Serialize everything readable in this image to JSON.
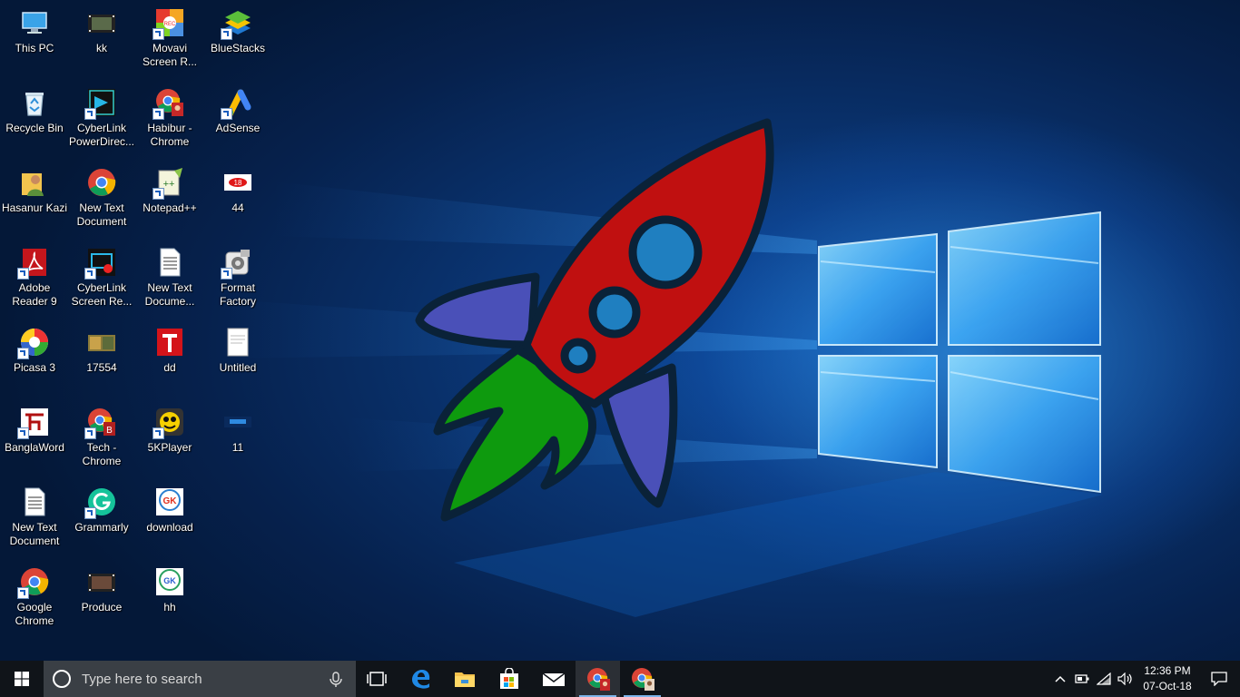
{
  "desktop": {
    "icons": [
      {
        "label": "This PC",
        "icon": "this-pc-icon",
        "shortcut": false
      },
      {
        "label": "kk",
        "icon": "video-file-icon",
        "shortcut": false
      },
      {
        "label": "Movavi Screen R...",
        "icon": "movavi-icon",
        "shortcut": true
      },
      {
        "label": "BlueStacks",
        "icon": "bluestacks-icon",
        "shortcut": true
      },
      {
        "label": "Recycle Bin",
        "icon": "recycle-bin-icon",
        "shortcut": false
      },
      {
        "label": "CyberLink PowerDirec...",
        "icon": "powerdirector-icon",
        "shortcut": true
      },
      {
        "label": "Habibur - Chrome",
        "icon": "chrome-profile-icon",
        "shortcut": true
      },
      {
        "label": "AdSense",
        "icon": "adsense-icon",
        "shortcut": true
      },
      {
        "label": "Hasanur Kazi",
        "icon": "user-folder-icon",
        "shortcut": false
      },
      {
        "label": "New Text Document",
        "icon": "chrome-icon",
        "shortcut": false
      },
      {
        "label": "Notepad++",
        "icon": "notepad-plus-icon",
        "shortcut": true
      },
      {
        "label": "44",
        "icon": "image-file-icon",
        "shortcut": false
      },
      {
        "label": "Adobe Reader 9",
        "icon": "adobe-reader-icon",
        "shortcut": true
      },
      {
        "label": "CyberLink Screen Re...",
        "icon": "screen-recorder-icon",
        "shortcut": true
      },
      {
        "label": "New Text Docume...",
        "icon": "text-document-icon",
        "shortcut": false
      },
      {
        "label": "Format Factory",
        "icon": "format-factory-icon",
        "shortcut": true
      },
      {
        "label": "Picasa 3",
        "icon": "picasa-icon",
        "shortcut": true
      },
      {
        "label": "17554",
        "icon": "photo-file-icon",
        "shortcut": false
      },
      {
        "label": "dd",
        "icon": "red-t-icon",
        "shortcut": false
      },
      {
        "label": "Untitled",
        "icon": "blank-document-icon",
        "shortcut": false
      },
      {
        "label": "BanglaWord",
        "icon": "banglaword-icon",
        "shortcut": true
      },
      {
        "label": "Tech - Chrome",
        "icon": "chrome-profile-icon",
        "shortcut": true
      },
      {
        "label": "5KPlayer",
        "icon": "5kplayer-icon",
        "shortcut": true
      },
      {
        "label": "11",
        "icon": "blue-image-icon",
        "shortcut": false
      },
      {
        "label": "New Text Document",
        "icon": "text-document-icon",
        "shortcut": false
      },
      {
        "label": "Grammarly",
        "icon": "grammarly-icon",
        "shortcut": true
      },
      {
        "label": "download",
        "icon": "gk-image-icon",
        "shortcut": false
      },
      {
        "label": "Google Chrome",
        "icon": "chrome-icon",
        "shortcut": true
      },
      {
        "label": "Produce",
        "icon": "video-file-icon",
        "shortcut": false
      },
      {
        "label": "hh",
        "icon": "gk-image-icon",
        "shortcut": false
      }
    ]
  },
  "taskbar": {
    "search_placeholder": "Type here to search",
    "pinned": [
      "task-view-icon",
      "edge-icon",
      "file-explorer-icon",
      "store-icon",
      "mail-icon",
      "chrome-profile-icon",
      "chrome-profile-icon"
    ],
    "clock_time": "12:36 PM",
    "clock_date": "07-Oct-18"
  },
  "colors": {
    "taskbar": "#101419",
    "search_box": "#3a3f45",
    "rocket_body": "#c01010",
    "rocket_fins": "#4a50b8",
    "rocket_flame": "#0e9a0e",
    "rocket_outline": "#0a2238",
    "window_glow": "#5ec3ff"
  }
}
